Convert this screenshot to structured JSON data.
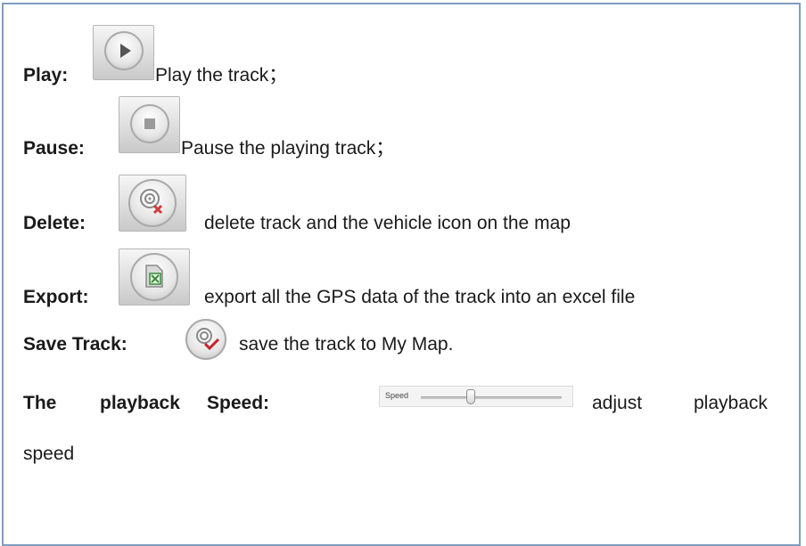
{
  "rows": {
    "play": {
      "label": "Play:",
      "text": "Play the track；"
    },
    "pause": {
      "label": "Pause:",
      "text": "Pause the playing track；"
    },
    "delete": {
      "label": "Delete:",
      "text": "delete track and the vehicle icon on the map"
    },
    "export": {
      "label": "Export:",
      "text": "export all the GPS data of the track into an excel file"
    },
    "save": {
      "label": "Save Track:",
      "text": "save the track to My Map."
    },
    "speed": {
      "label_the": "The",
      "label_playback": "playback",
      "label_speed": "Speed:",
      "text_adjust": "adjust",
      "text_playback": "playback",
      "text_speed": "speed",
      "slider_label": "Speed",
      "slider_value": 0.35
    }
  },
  "icons": {
    "play": "play-icon",
    "pause": "stop-icon",
    "delete": "delete-track-icon",
    "export": "export-excel-icon",
    "save": "save-track-icon"
  },
  "colors": {
    "border": "#7f9dbf",
    "delete_mark": "#d23b3b",
    "export_mark": "#3a8a3a",
    "save_mark": "#c4232b"
  }
}
